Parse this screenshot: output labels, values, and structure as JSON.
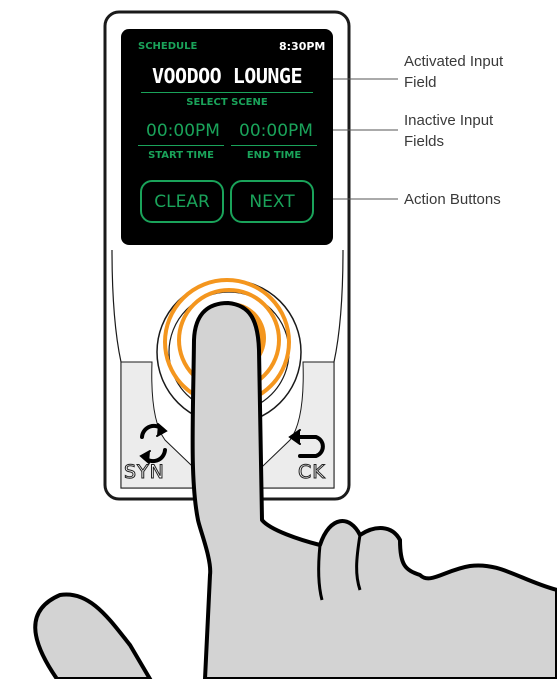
{
  "screen": {
    "header_left": "SCHEDULE",
    "clock": "8:30PM",
    "active_field_value": "VOODOO LOUNGE",
    "active_field_label": "SELECT SCENE",
    "start_value": "00:00PM",
    "start_label": "START TIME",
    "end_value": "00:00PM",
    "end_label": "END TIME",
    "clear_label": "CLEAR",
    "next_label": "NEXT"
  },
  "device": {
    "brand_left": "SYN",
    "brand_right": "CK"
  },
  "callouts": {
    "activated": [
      "Activated Input",
      "Field"
    ],
    "inactive": [
      "Inactive Input",
      "Fields"
    ],
    "actions": "Action Buttons"
  },
  "colors": {
    "screen_text": "#1aa35a",
    "touch_ring": "#f4961e",
    "hand_fill": "#d3d3d3"
  },
  "icons": [
    "refresh-icon",
    "back-arrow-icon",
    "pointing-hand"
  ]
}
